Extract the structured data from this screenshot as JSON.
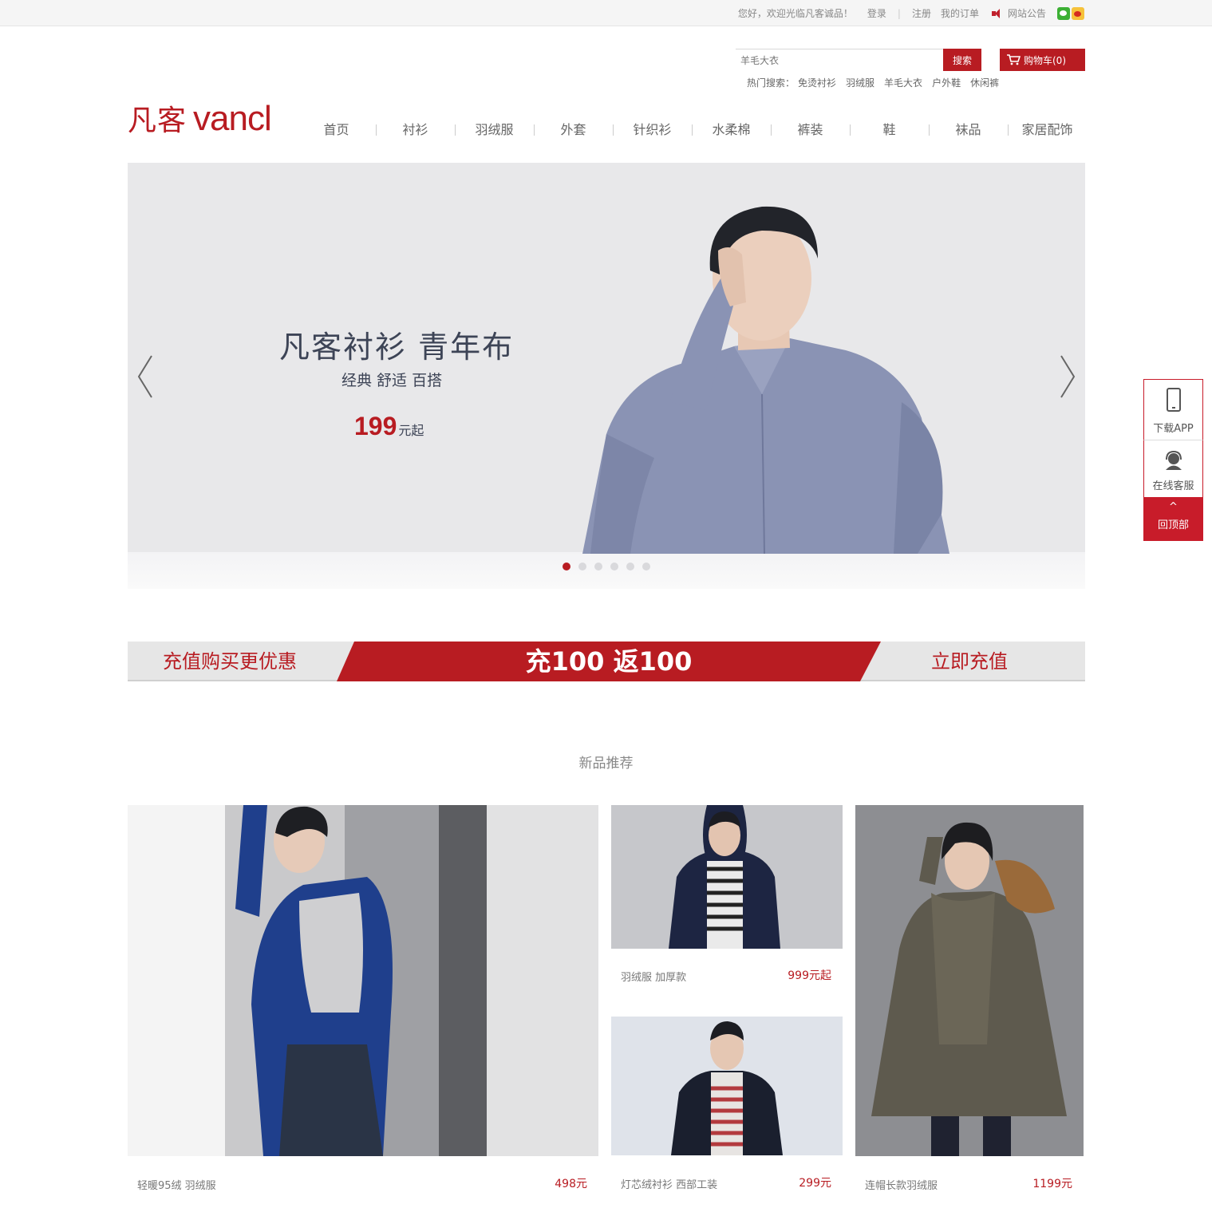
{
  "topbar": {
    "welcome": "您好，欢迎光临凡客诚品！",
    "login": "登录",
    "separator": "|",
    "register": "注册",
    "orders": "我的订单",
    "notice": "网站公告",
    "icons": [
      "speaker-icon",
      "wechat-icon",
      "weibo-icon"
    ]
  },
  "search": {
    "placeholder": "羊毛大衣",
    "button": "搜索",
    "cart": "购物车(0)",
    "hot_label": "热门搜索：",
    "hot_terms": [
      "免烫衬衫",
      "羽绒服",
      "羊毛大衣",
      "户外鞋",
      "休闲裤"
    ]
  },
  "logo": {
    "cn": "凡客",
    "en": "vancl"
  },
  "nav": [
    "首页",
    "衬衫",
    "羽绒服",
    "外套",
    "针织衫",
    "水柔棉",
    "裤装",
    "鞋",
    "袜品",
    "家居配饰"
  ],
  "banner": {
    "title": "凡客衬衫 青年布",
    "subtitle": "经典 舒适 百搭",
    "price": "199",
    "price_unit": "元起",
    "slide_count": 6,
    "active_slide": 1
  },
  "promo": {
    "left": "充值购买更优惠",
    "middle": "充100 返100",
    "right": "立即充值"
  },
  "section_title": "新品推荐",
  "products": [
    {
      "name": "轻暖95绒 羽绒服",
      "price": "498元"
    },
    {
      "name": "羽绒服 加厚款",
      "price": "999元起"
    },
    {
      "name": "灯芯绒衬衫 西部工装",
      "price": "299元"
    },
    {
      "name": "连帽长款羽绒服",
      "price": "1199元"
    }
  ],
  "side": {
    "app": "下载APP",
    "service": "在线客服",
    "top_arrow": "^",
    "top": "回顶部"
  },
  "colors": {
    "brand": "#b81c22",
    "text": "#666666",
    "banner_text": "#3d4456"
  }
}
